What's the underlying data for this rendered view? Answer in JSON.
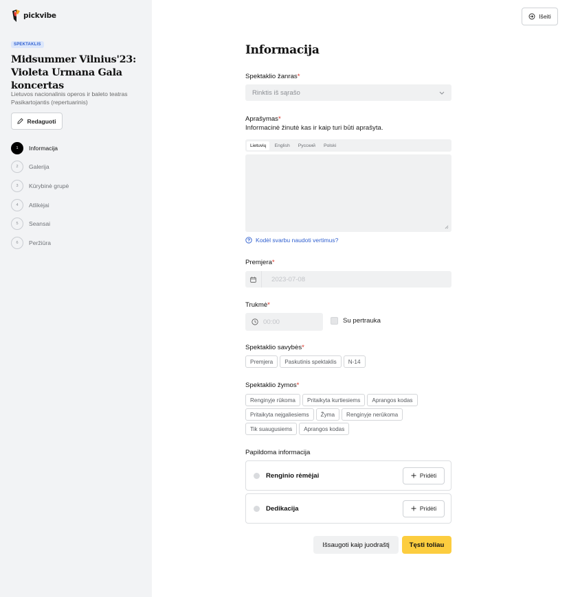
{
  "brand": {
    "name": "pickvibe"
  },
  "sidebar": {
    "badge": "SPEKTAKLIS",
    "event_title": "Midsummer Vilnius'23: Violeta Urmana Gala koncertas",
    "venue_line1": "Lietuvos nacionalinis operos ir baleto teatras",
    "venue_line2": "Pasikartojantis (repertuarinis)",
    "edit_label": "Redaguoti",
    "steps": [
      {
        "num": "1",
        "label": "Informacija"
      },
      {
        "num": "2",
        "label": "Galerija"
      },
      {
        "num": "3",
        "label": "Kūrybinė grupė"
      },
      {
        "num": "4",
        "label": "Atlikėjai"
      },
      {
        "num": "5",
        "label": "Seansai"
      },
      {
        "num": "6",
        "label": "Peržiūra"
      }
    ]
  },
  "header": {
    "logout_label": "Išeiti"
  },
  "form": {
    "title": "Informacija",
    "genre": {
      "label": "Spektaklio žanras",
      "placeholder": "Rinktis iš sąrašo"
    },
    "description": {
      "label": "Aprašymas",
      "hint": "Informacinė žinutė kas ir kaip turi būti aprašyta.",
      "tabs": [
        "Lietuvių",
        "English",
        "Русский",
        "Polski"
      ],
      "help_link": "Kodėl svarbu naudoti vertimus?"
    },
    "premiere": {
      "label": "Premjera",
      "placeholder": "2023-07-08"
    },
    "duration": {
      "label": "Trukmė",
      "placeholder": "00:00",
      "break_label": "Su pertrauka"
    },
    "features": {
      "label": "Spektaklio savybės",
      "chips": [
        "Premjera",
        "Paskutinis spektaklis",
        "N-14"
      ]
    },
    "tags": {
      "label": "Spektaklio žymos",
      "chips": [
        "Renginyje rūkoma",
        "Pritaikyta kurtiesiems",
        "Aprangos kodas",
        "Pritaikyta neįgaliesiems",
        "Žyma",
        "Renginyje nerūkoma",
        "Tik suaugusiems",
        "Aprangos kodas"
      ]
    },
    "additional": {
      "label": "Papildoma informacija",
      "cards": [
        {
          "label": "Renginio rėmėjai",
          "button": "Pridėti"
        },
        {
          "label": "Dedikacija",
          "button": "Pridėti"
        }
      ]
    },
    "required_mark": "*",
    "save_draft_label": "Išsaugoti kaip juodraštį",
    "continue_label": "Tęsti toliau"
  },
  "colors": {
    "accent": "#fccd3f",
    "link": "#2f5fcf",
    "required": "#d92d20",
    "sidebar_bg": "#f2f3f5"
  }
}
